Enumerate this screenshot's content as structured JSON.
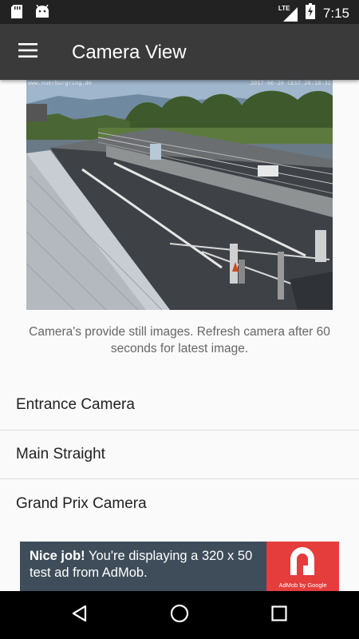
{
  "status_bar": {
    "time": "7:15",
    "network": "LTE",
    "icons": [
      "sd-card-icon",
      "android-icon",
      "signal-icon",
      "battery-charging-icon"
    ]
  },
  "app_bar": {
    "title": "Camera View",
    "menu_icon": "hamburger-menu-icon"
  },
  "camera": {
    "stamp_left": "www.nuerburgring.de",
    "stamp_right": "2017-06-20 CEST 20:18:32"
  },
  "info_text": "Camera's provide still images. Refresh camera after 60 seconds for latest image.",
  "cameras": [
    {
      "label": "Entrance Camera"
    },
    {
      "label": "Main Straight"
    },
    {
      "label": "Grand Prix Camera"
    }
  ],
  "ad": {
    "headline": "Nice job!",
    "body": " You're displaying a 320 x 50 test ad from AdMob.",
    "brand": "AdMob by Google",
    "colors": {
      "background": "#3f4d5a",
      "logo": "#e53c3c"
    }
  },
  "nav": {
    "icons": [
      "back-icon",
      "home-icon",
      "recents-icon"
    ]
  }
}
